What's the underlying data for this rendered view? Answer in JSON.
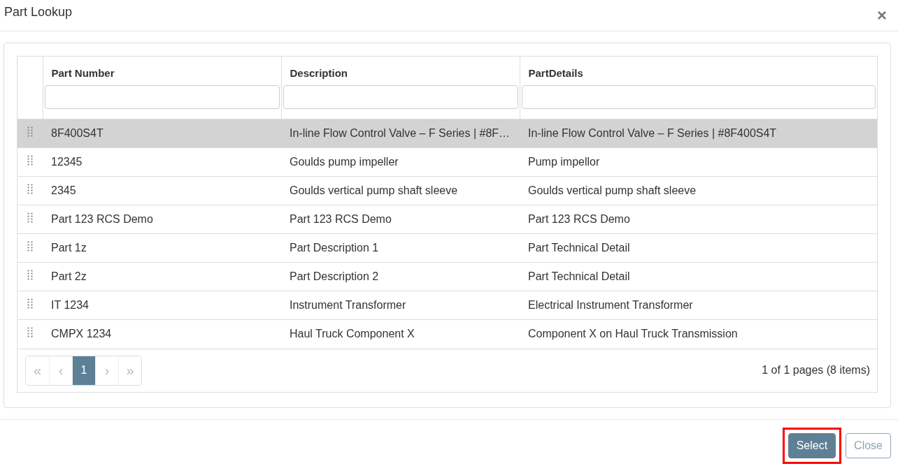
{
  "dialog": {
    "title": "Part Lookup",
    "close": "×"
  },
  "table": {
    "columns": [
      {
        "label": "Part Number"
      },
      {
        "label": "Description"
      },
      {
        "label": "PartDetails"
      }
    ],
    "rows": [
      {
        "selected": true,
        "cells": [
          "8F400S4T",
          "In-line Flow Control Valve – F Series | #8F…",
          "In-line Flow Control Valve – F Series | #8F400S4T"
        ]
      },
      {
        "selected": false,
        "cells": [
          "12345",
          "Goulds pump impeller",
          "Pump impellor"
        ]
      },
      {
        "selected": false,
        "cells": [
          "2345",
          "Goulds vertical pump shaft sleeve",
          "Goulds vertical pump shaft sleeve"
        ]
      },
      {
        "selected": false,
        "cells": [
          "Part 123 RCS Demo",
          "Part 123 RCS Demo",
          "Part 123 RCS Demo"
        ]
      },
      {
        "selected": false,
        "cells": [
          "Part 1z",
          "Part Description 1",
          "Part Technical Detail"
        ]
      },
      {
        "selected": false,
        "cells": [
          "Part 2z",
          "Part Description 2",
          "Part Technical Detail"
        ]
      },
      {
        "selected": false,
        "cells": [
          "IT 1234",
          "Instrument Transformer",
          "Electrical Instrument Transformer"
        ]
      },
      {
        "selected": false,
        "cells": [
          "CMPX 1234",
          "Haul Truck Component X",
          "Component X on Haul Truck Transmission"
        ]
      }
    ]
  },
  "pager": {
    "buttons": [
      {
        "kind": "nav",
        "label": "«",
        "selected": false
      },
      {
        "kind": "nav",
        "label": "‹",
        "selected": false
      },
      {
        "kind": "page",
        "label": "1",
        "selected": true
      },
      {
        "kind": "nav",
        "label": "›",
        "selected": false
      },
      {
        "kind": "nav",
        "label": "»",
        "selected": false
      }
    ],
    "info": "1 of 1 pages (8 items)"
  },
  "footer": {
    "buttons": [
      {
        "kind": "primary",
        "label": "Select",
        "highlighted": true
      },
      {
        "kind": "outline",
        "label": "Close",
        "highlighted": false
      }
    ]
  }
}
